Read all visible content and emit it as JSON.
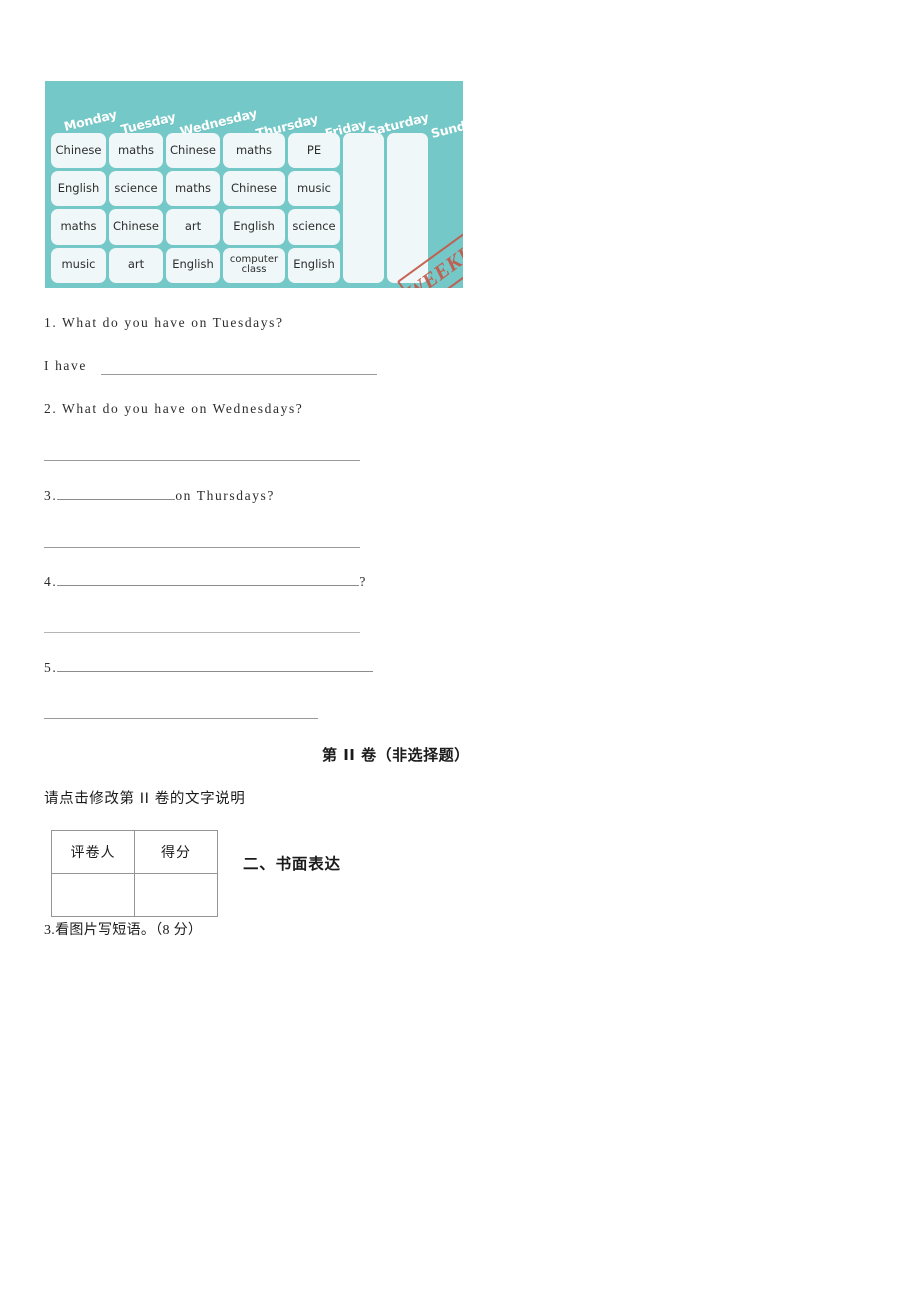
{
  "timetable": {
    "alt": "weekly school timetable",
    "colors": {
      "background": "#74c8c8",
      "cell": "#eff7f8",
      "stamp": "#c4594a",
      "day_text": "#ffffff"
    },
    "days": [
      "Monday",
      "Tuesday",
      "Wednesday",
      "Thursday",
      "Friday",
      "Saturday",
      "Sunday"
    ],
    "columns": [
      {
        "day": "Monday",
        "subjects": [
          "Chinese",
          "English",
          "maths",
          "music"
        ]
      },
      {
        "day": "Tuesday",
        "subjects": [
          "maths",
          "science",
          "Chinese",
          "art"
        ]
      },
      {
        "day": "Wednesday",
        "subjects": [
          "Chinese",
          "maths",
          "art",
          "English"
        ]
      },
      {
        "day": "Thursday",
        "subjects": [
          "maths",
          "Chinese",
          "English",
          "computer class"
        ]
      },
      {
        "day": "Friday",
        "subjects": [
          "PE",
          "music",
          "science",
          "English"
        ]
      },
      {
        "day": "Saturday",
        "subjects": []
      },
      {
        "day": "Sunday",
        "subjects": []
      }
    ],
    "stamp_label": "WEEKEND"
  },
  "exercise": {
    "q1": "1. What do you have on Tuesdays?",
    "q1_answer_prefix": "I have",
    "q2": "2. What do you have on Wednesdays?",
    "q3_number": "3.",
    "q3_tail": "on Thursdays?",
    "q4_number": "4.",
    "q4_tail": "?",
    "q5_number": "5."
  },
  "part2": {
    "heading": "第 II 卷（非选择题）",
    "note": "请点击修改第 II 卷的文字说明"
  },
  "grading": {
    "headers": [
      "评卷人",
      "得分"
    ],
    "values": [
      "",
      ""
    ]
  },
  "section": {
    "title": "二、书面表达",
    "prompt": "3.看图片写短语。（8 分）"
  }
}
